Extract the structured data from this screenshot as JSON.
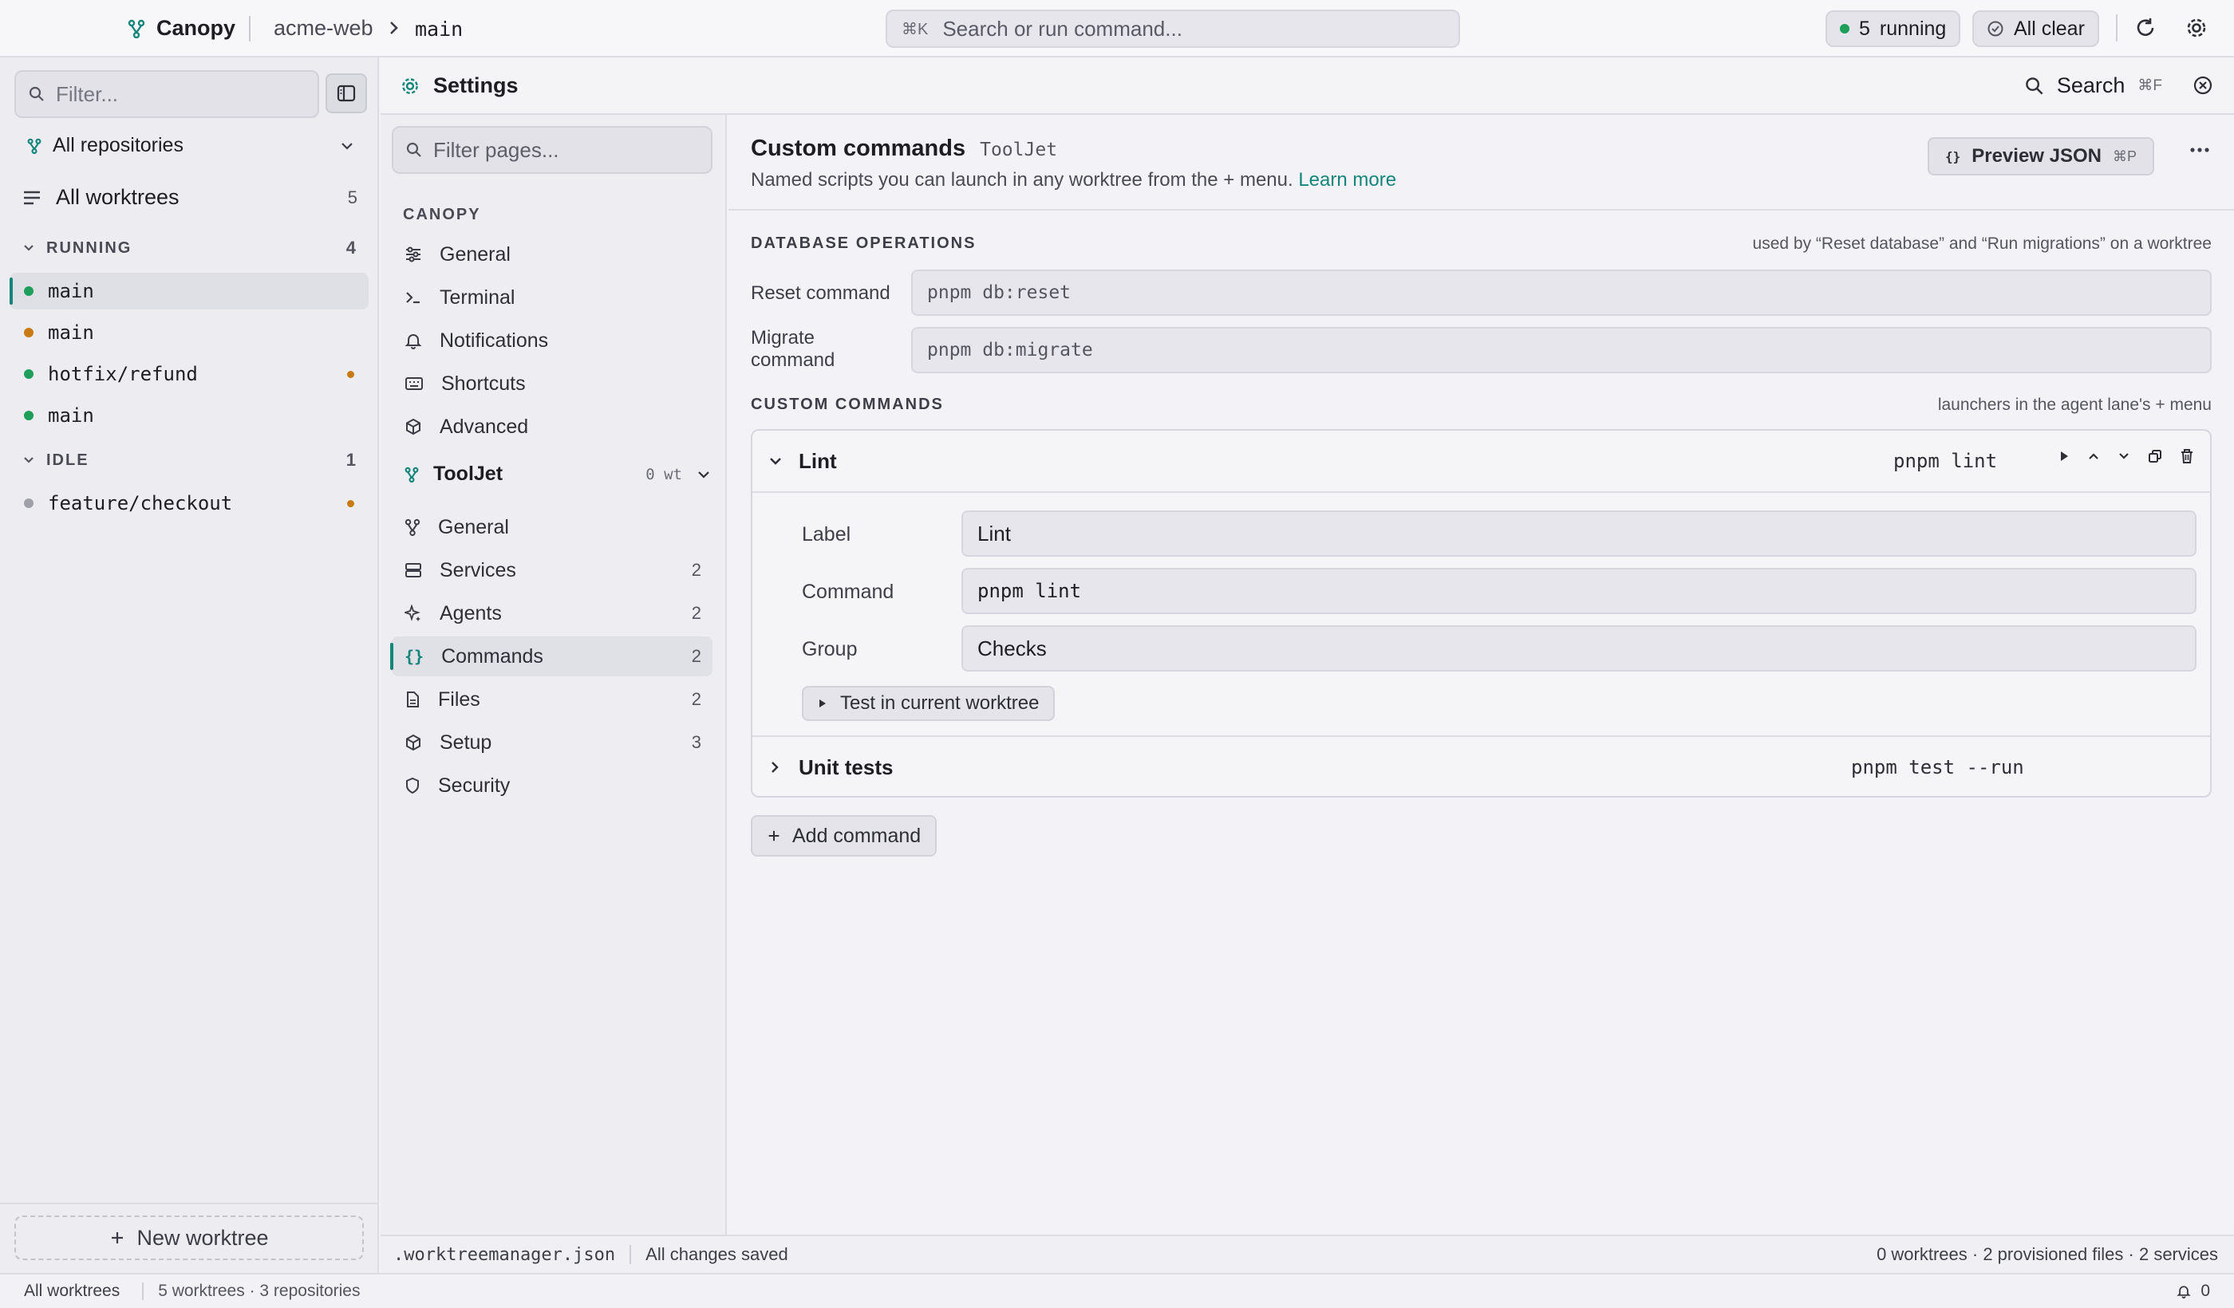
{
  "topbar": {
    "app_name": "Canopy",
    "repo": "acme-web",
    "branch": "main",
    "command_shortcut": "⌘K",
    "command_placeholder": "Search or run command...",
    "running_count": "5",
    "running_label": "running",
    "all_clear_label": "All clear"
  },
  "sidebar": {
    "filter_placeholder": "Filter...",
    "repo_select": "All repositories",
    "all_worktrees_label": "All worktrees",
    "all_worktrees_count": "5",
    "running_group": {
      "label": "RUNNING",
      "count": "4"
    },
    "running_items": [
      {
        "name": "main",
        "status": "green",
        "flag": false
      },
      {
        "name": "main",
        "status": "orange",
        "flag": false
      },
      {
        "name": "hotfix/refund",
        "status": "green",
        "flag": true
      },
      {
        "name": "main",
        "status": "green",
        "flag": false
      }
    ],
    "idle_group": {
      "label": "IDLE",
      "count": "1"
    },
    "idle_items": [
      {
        "name": "feature/checkout",
        "status": "gray",
        "flag": true
      }
    ],
    "new_worktree_label": "New worktree"
  },
  "settings": {
    "title": "Settings",
    "search_label": "Search",
    "search_shortcut": "⌘F"
  },
  "settings_nav": {
    "filter_placeholder": "Filter pages...",
    "section_label": "CANOPY",
    "canopy_items": [
      {
        "label": "General",
        "icon": "sliders-icon"
      },
      {
        "label": "Terminal",
        "icon": "terminal-icon"
      },
      {
        "label": "Notifications",
        "icon": "bell-icon"
      },
      {
        "label": "Shortcuts",
        "icon": "keyboard-icon"
      },
      {
        "label": "Advanced",
        "icon": "cube-icon"
      }
    ],
    "repo_name": "ToolJet",
    "repo_wt": "0 wt",
    "repo_items": [
      {
        "label": "General",
        "icon": "branch-icon",
        "count": ""
      },
      {
        "label": "Services",
        "icon": "server-icon",
        "count": "2"
      },
      {
        "label": "Agents",
        "icon": "sparkle-icon",
        "count": "2"
      },
      {
        "label": "Commands",
        "icon": "braces-icon",
        "count": "2"
      },
      {
        "label": "Files",
        "icon": "file-icon",
        "count": "2"
      },
      {
        "label": "Setup",
        "icon": "cube-icon",
        "count": "3"
      },
      {
        "label": "Security",
        "icon": "shield-icon",
        "count": ""
      }
    ]
  },
  "content": {
    "title": "Custom commands",
    "repo_tag": "ToolJet",
    "description": "Named scripts you can launch in any worktree from the + menu.",
    "learn_more": "Learn more",
    "preview_label": "Preview JSON",
    "preview_shortcut": "⌘P",
    "db_section": "DATABASE OPERATIONS",
    "db_note": "used by “Reset database” and “Run migrations” on a worktree",
    "reset_label": "Reset command",
    "reset_placeholder": "pnpm db:reset",
    "migrate_label_1": "Migrate",
    "migrate_label_2": "command",
    "migrate_placeholder": "pnpm db:migrate",
    "custom_section": "CUSTOM COMMANDS",
    "custom_note": "launchers in the agent lane's + menu",
    "commands": [
      {
        "name": "Lint",
        "command": "pnpm lint",
        "label": "Lint",
        "group": "Checks"
      },
      {
        "name": "Unit tests",
        "command": "pnpm test --run"
      }
    ],
    "field_label": "Label",
    "field_command": "Command",
    "field_group": "Group",
    "test_button": "Test in current worktree",
    "add_command": "Add command"
  },
  "statusbar": {
    "file": ".worktreemanager.json",
    "saved": "All changes saved",
    "summary": "0 worktrees · 2 provisioned files · 2 services"
  },
  "footer": {
    "scope": "All worktrees",
    "summary": "5 worktrees · 3 repositories",
    "notifications": "0"
  },
  "colors": {
    "accent": "#14857a",
    "running": "#1e9e5a",
    "warning": "#c97a14",
    "idle": "#a0a0a8"
  }
}
